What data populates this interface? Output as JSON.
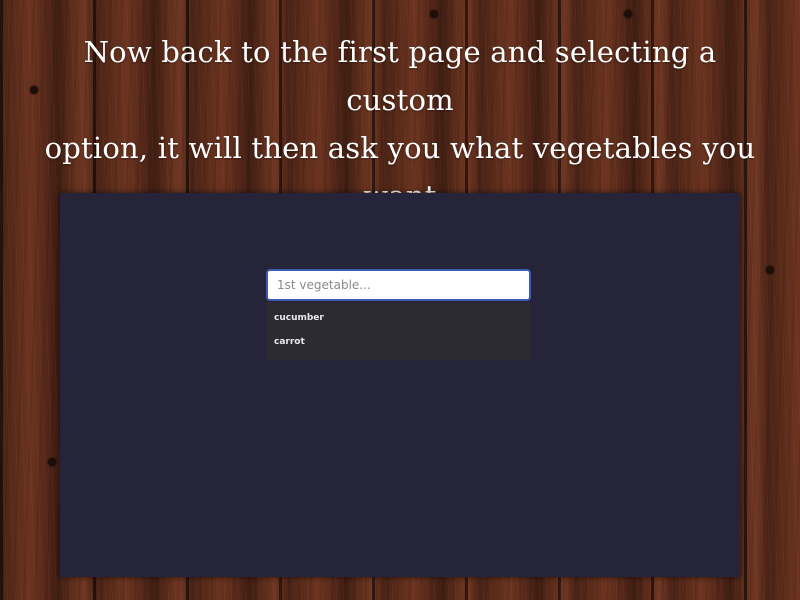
{
  "caption": {
    "line1": "Now back to the first page and selecting a custom",
    "line2": "option, it will then ask you what vegetables you",
    "line3": "want"
  },
  "search": {
    "value": "",
    "placeholder": "1st vegetable..."
  },
  "suggestions": [
    {
      "label": "cucumber"
    },
    {
      "label": "carrot"
    }
  ],
  "colors": {
    "screen_background": "#262438",
    "input_border": "#3e5bb3",
    "dropdown_background": "#2b2b31",
    "caption_text": "#ffffff"
  }
}
